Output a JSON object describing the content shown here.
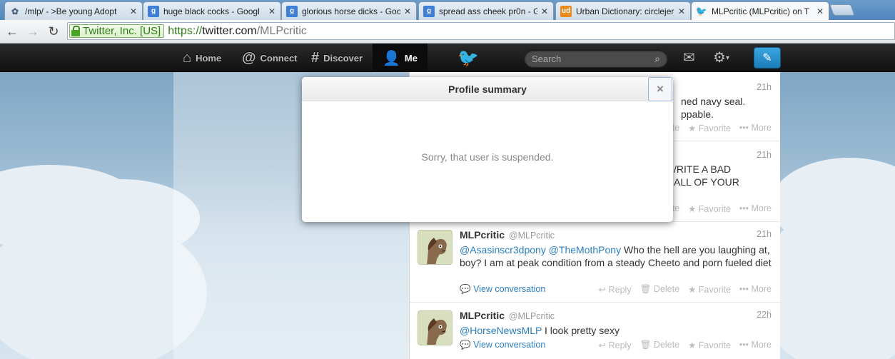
{
  "browser": {
    "tabs": [
      {
        "title": "/mlp/ - >Be young Adopt",
        "icon": "four-leaf-icon",
        "active": false
      },
      {
        "title": "huge black cocks - Googl",
        "icon": "google-icon",
        "active": false
      },
      {
        "title": "glorious horse dicks - Goo",
        "icon": "google-icon",
        "active": false
      },
      {
        "title": "spread ass cheek pr0n - Go",
        "icon": "google-icon",
        "active": false
      },
      {
        "title": "Urban Dictionary: circlejer",
        "icon": "urban-dictionary-icon",
        "active": false
      },
      {
        "title": "MLPcritic (MLPcritic) on T",
        "icon": "twitter-bird-icon",
        "active": true
      }
    ],
    "ev_label": "Twitter, Inc. [US]",
    "url": {
      "scheme": "https://",
      "host": "twitter.com",
      "path": "/MLPcritic"
    }
  },
  "twitter_nav": {
    "home": "Home",
    "connect": "Connect",
    "discover": "Discover",
    "me": "Me",
    "search_placeholder": "Search"
  },
  "modal": {
    "title": "Profile summary",
    "message": "Sorry, that user is suspended.",
    "close_glyph": "×"
  },
  "tweets": [
    {
      "time": "21h",
      "text_visible": "ned navy seal.",
      "text_visible_2": "ppable.",
      "actions": {
        "delete": "Delete",
        "favorite": "Favorite",
        "more": "More"
      }
    },
    {
      "time": "21h",
      "text_visible": "/RITE A BAD",
      "text_visible_2": "ALL OF YOUR",
      "actions": {
        "delete": "Delete",
        "favorite": "Favorite",
        "more": "More"
      }
    },
    {
      "fullname": "MLPcritic",
      "handle": "@MLPcritic",
      "time": "21h",
      "mention_1": "@Asasinscr3dpony",
      "mention_2": "@TheMothPony",
      "text": "Who the hell are you laughing at, boy? I am at peak condition from a steady Cheeto and porn fueled diet",
      "view_conversation": "View conversation",
      "actions": {
        "reply": "Reply",
        "delete": "Delete",
        "favorite": "Favorite",
        "more": "More"
      }
    },
    {
      "fullname": "MLPcritic",
      "handle": "@MLPcritic",
      "time": "22h",
      "mention_1": "@HorseNewsMLP",
      "text": "I look pretty sexy",
      "view_conversation": "View conversation",
      "actions": {
        "reply": "Reply",
        "delete": "Delete",
        "favorite": "Favorite",
        "more": "More"
      }
    }
  ]
}
